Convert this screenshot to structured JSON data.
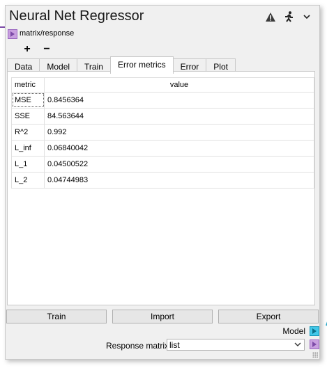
{
  "node": {
    "title": "Neural Net Regressor",
    "input_port_label": "matrix/response",
    "plus_label": "+",
    "minus_label": "−",
    "icons": [
      "warning-icon",
      "running-man-icon",
      "chevron-down-icon"
    ]
  },
  "tabs": [
    {
      "label": "Data"
    },
    {
      "label": "Model"
    },
    {
      "label": "Train"
    },
    {
      "label": "Error metrics",
      "active": true
    },
    {
      "label": "Error"
    },
    {
      "label": "Plot"
    }
  ],
  "table": {
    "headers": {
      "metric": "metric",
      "value": "value"
    },
    "rows": [
      {
        "metric": "MSE",
        "value": "0.8456364"
      },
      {
        "metric": "SSE",
        "value": "84.563644"
      },
      {
        "metric": "R^2",
        "value": "0.992"
      },
      {
        "metric": "L_inf",
        "value": "0.06840042"
      },
      {
        "metric": "L_1",
        "value": "0.04500522"
      },
      {
        "metric": "L_2",
        "value": "0.04744983"
      }
    ]
  },
  "buttons": {
    "train": "Train",
    "import": "Import",
    "export": "Export"
  },
  "outputs": {
    "model_label": "Model"
  },
  "response": {
    "label": "Response matrix",
    "selected": "list"
  },
  "colors": {
    "output_port": "#42c7e8",
    "input_port": "#c9a0e0"
  }
}
